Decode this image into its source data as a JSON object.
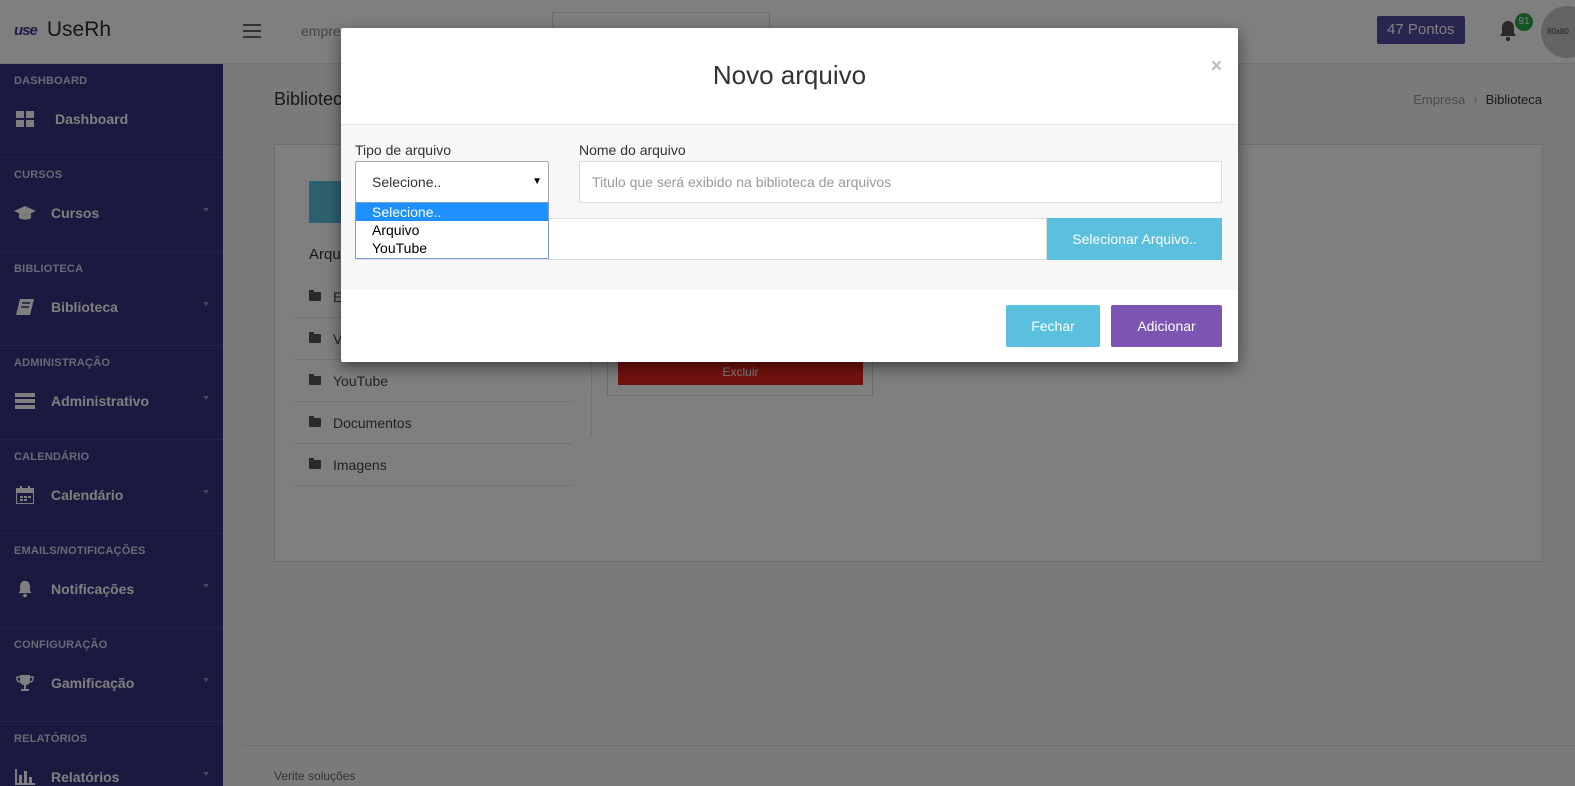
{
  "header": {
    "logo_mark": "use",
    "app_name": "UseRh",
    "company_text": "empre",
    "points_label": "47 Pontos",
    "notification_count": "91",
    "avatar_text": "80x80"
  },
  "sidebar": {
    "sections": [
      {
        "heading": "DASHBOARD",
        "label": "Dashboard",
        "icon": "dashboard-grid-icon"
      },
      {
        "heading": "CURSOS",
        "label": "Cursos",
        "icon": "graduation-cap-icon"
      },
      {
        "heading": "BIBLIOTECA",
        "label": "Biblioteca",
        "icon": "book-icon"
      },
      {
        "heading": "ADMINISTRAÇÃO",
        "label": "Administrativo",
        "icon": "server-icon"
      },
      {
        "heading": "CALENDÁRIO",
        "label": "Calendário",
        "icon": "calendar-icon"
      },
      {
        "heading": "EMAILS/NOTIFICAÇÕES",
        "label": "Notificações",
        "icon": "bell-icon"
      },
      {
        "heading": "CONFIGURAÇÃO",
        "label": "Gamificação",
        "icon": "trophy-icon"
      },
      {
        "heading": "RELATÓRIOS",
        "label": "Relatórios",
        "icon": "bar-chart-icon"
      }
    ]
  },
  "page": {
    "title": "Bibliotec",
    "breadcrumb": [
      "Empresa",
      "Biblioteca"
    ],
    "arquivos_label": "Arqu",
    "folders": [
      "E",
      "V",
      "YouTube",
      "Documentos",
      "Imagens"
    ],
    "delete_label": "Excluir",
    "footer": "Verite soluções"
  },
  "modal": {
    "title": "Novo arquivo",
    "close": "×",
    "type_label": "Tipo de arquivo",
    "type_value": "Selecione..",
    "type_options": [
      "Selecione..",
      "Arquivo",
      "YouTube"
    ],
    "name_label": "Nome do arquivo",
    "name_placeholder": "Titulo que será exibido na biblioteca de arquivos",
    "select_file_label": "Selecionar Arquivo..",
    "close_button": "Fechar",
    "add_button": "Adicionar"
  },
  "colors": {
    "sidebar_bg": "#35337f",
    "brand_purple": "#514ca3",
    "info_blue": "#5bc0de",
    "add_purple": "#7c54b2",
    "danger_red": "#e8251f",
    "notification_green": "#29a745"
  }
}
